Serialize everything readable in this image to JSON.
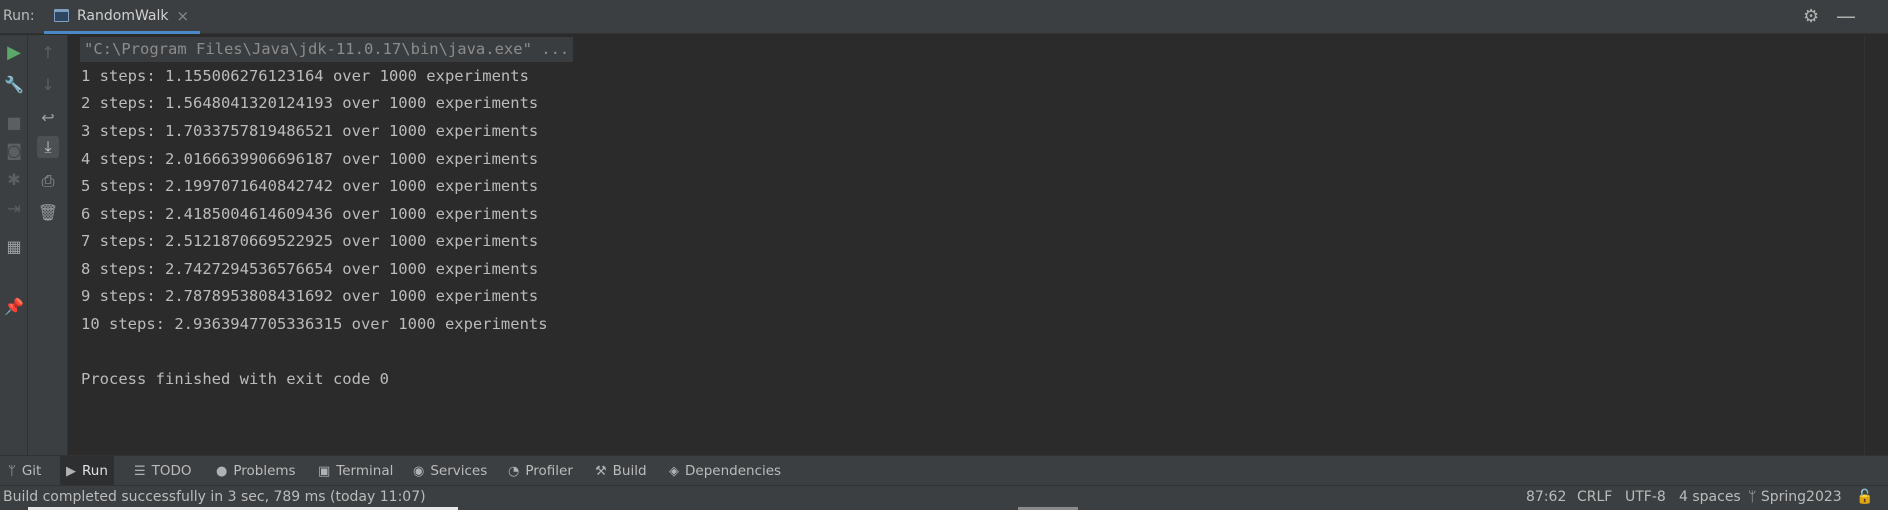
{
  "header": {
    "run_label": "Run:",
    "tab_label": "RandomWalk",
    "tab_close": "×"
  },
  "console": {
    "command": "\"C:\\Program Files\\Java\\jdk-11.0.17\\bin\\java.exe\" ...",
    "lines": [
      "1 steps: 1.155006276123164 over 1000 experiments",
      "2 steps: 1.5648041320124193 over 1000 experiments",
      "3 steps: 1.7033757819486521 over 1000 experiments",
      "4 steps: 2.0166639906696187 over 1000 experiments",
      "5 steps: 2.1997071640842742 over 1000 experiments",
      "6 steps: 2.4185004614609436 over 1000 experiments",
      "7 steps: 2.5121870669522925 over 1000 experiments",
      "8 steps: 2.7427294536576654 over 1000 experiments",
      "9 steps: 2.7878953808431692 over 1000 experiments",
      "10 steps: 2.9363947705336315 over 1000 experiments"
    ],
    "exit_message": "Process finished with exit code 0"
  },
  "tool_tabs": [
    {
      "label": "Git",
      "icon": "git-branch-icon"
    },
    {
      "label": "Run",
      "icon": "run-icon"
    },
    {
      "label": "TODO",
      "icon": "list-icon"
    },
    {
      "label": "Problems",
      "icon": "problems-icon"
    },
    {
      "label": "Terminal",
      "icon": "terminal-icon"
    },
    {
      "label": "Services",
      "icon": "services-icon"
    },
    {
      "label": "Profiler",
      "icon": "profiler-icon"
    },
    {
      "label": "Build",
      "icon": "hammer-icon"
    },
    {
      "label": "Dependencies",
      "icon": "dependencies-icon"
    }
  ],
  "status_bar": {
    "message": "Build completed successfully in 3 sec, 789 ms (today 11:07)",
    "position": "87:62",
    "line_separator": "CRLF",
    "encoding": "UTF-8",
    "indent": "4 spaces",
    "branch": "Spring2023"
  },
  "colors": {
    "accent": "#4a88c7",
    "run_green": "#59a869",
    "panel_bg": "#3c3f41",
    "console_bg": "#2b2b2b"
  }
}
